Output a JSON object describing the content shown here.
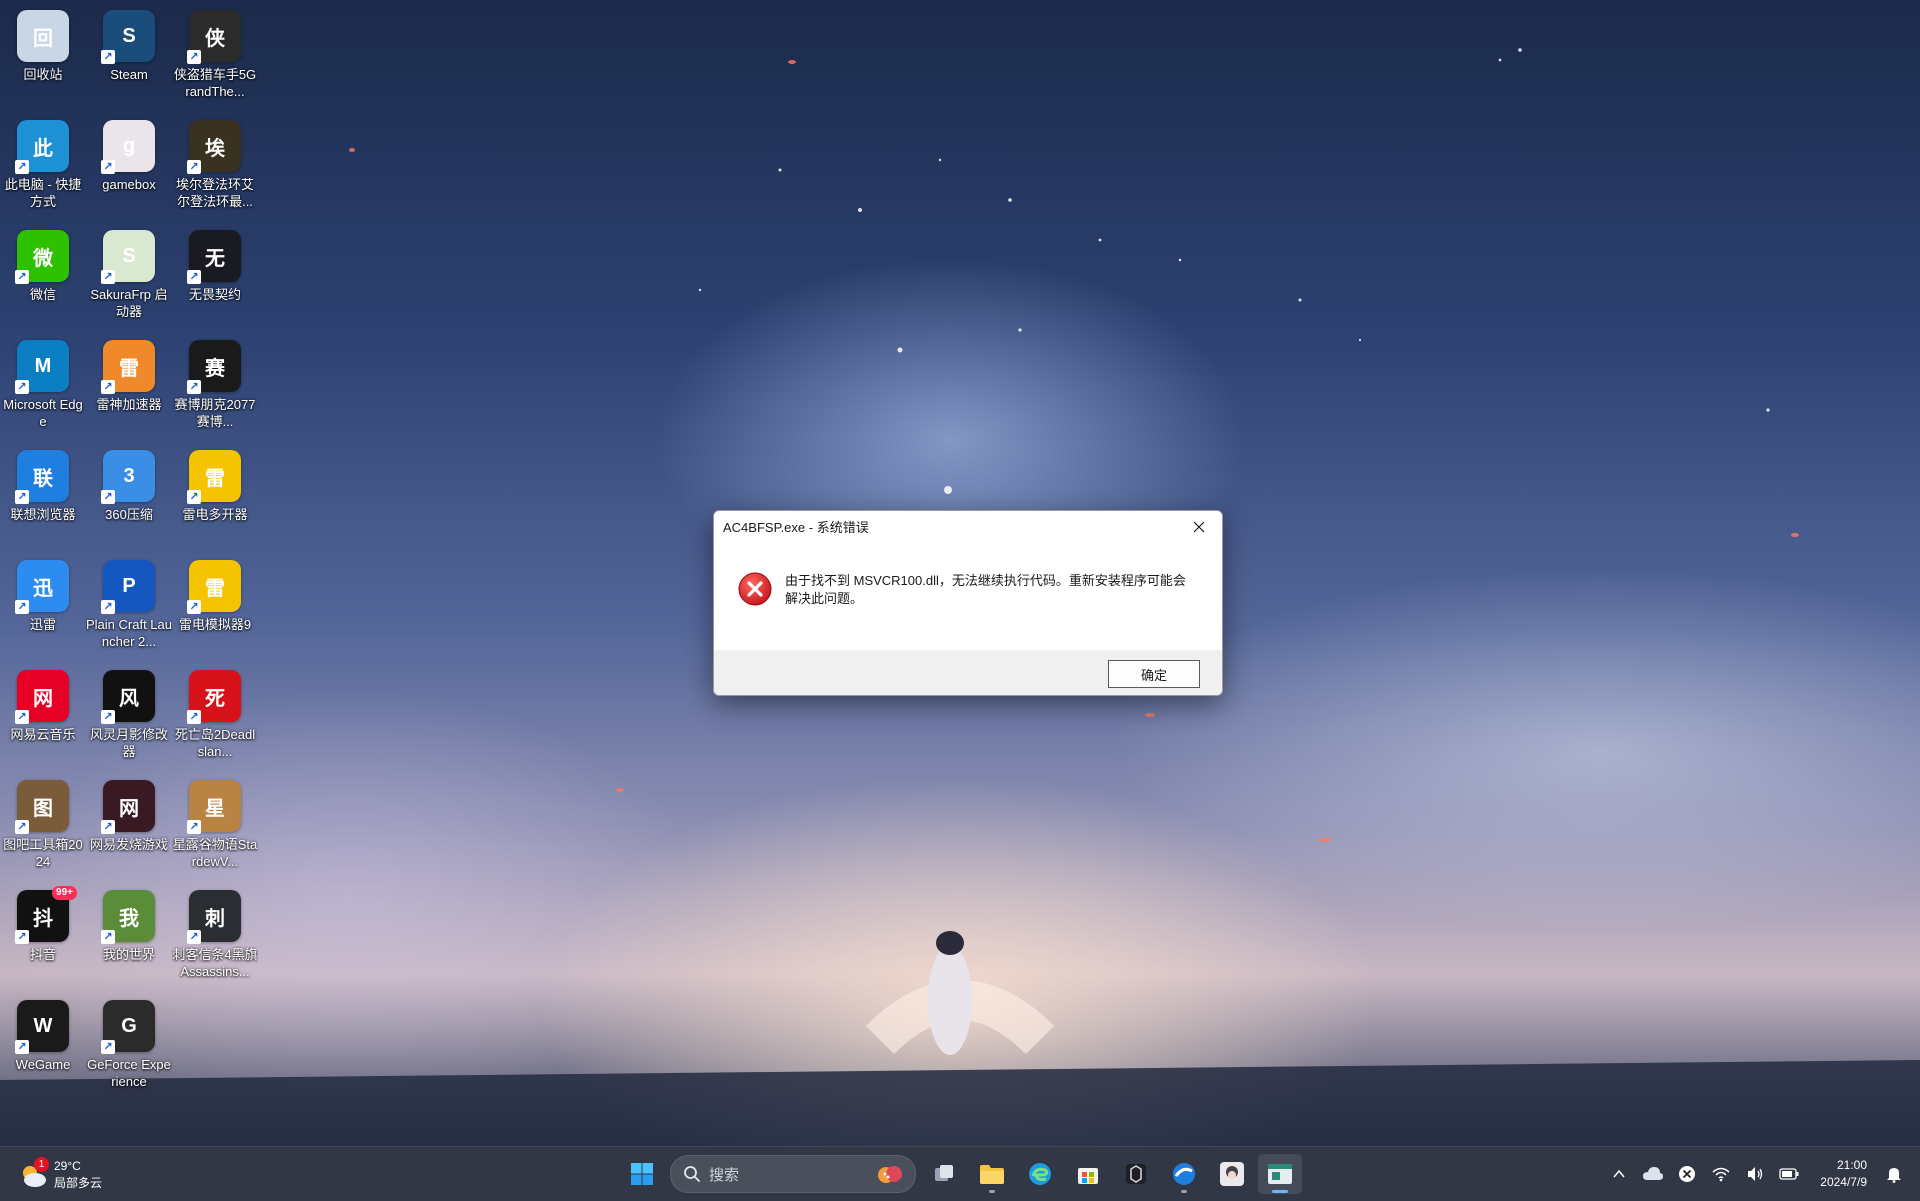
{
  "desktop_icons": [
    {
      "label": "回收站",
      "icon": "recycle-bin-icon",
      "color": "#c9d6e6"
    },
    {
      "label": "Steam",
      "icon": "steam-icon",
      "color": "#1b4d7a"
    },
    {
      "label": "侠盗猎车手5GrandThe...",
      "icon": "gta-v-icon",
      "color": "#2b2b2b"
    },
    {
      "label": "此电脑 - 快捷方式",
      "icon": "computer-icon",
      "color": "#1e90d6"
    },
    {
      "label": "gamebox",
      "icon": "gamebox-icon",
      "color": "#e9e5ea"
    },
    {
      "label": "埃尔登法环艾尔登法环最...",
      "icon": "elden-ring-icon",
      "color": "#3a3220"
    },
    {
      "label": "微信",
      "icon": "wechat-icon",
      "color": "#2dc100"
    },
    {
      "label": "SakuraFrp 启动器",
      "icon": "sakurafrp-icon",
      "color": "#d9e8d0"
    },
    {
      "label": "无畏契约",
      "icon": "valorant-icon",
      "color": "#1a1a22"
    },
    {
      "label": "Microsoft Edge",
      "icon": "edge-icon",
      "color": "#0c7fc4"
    },
    {
      "label": "雷神加速器",
      "icon": "leishen-accelerator-icon",
      "color": "#f0892a"
    },
    {
      "label": "赛博朋克2077赛博...",
      "icon": "cyberpunk-icon",
      "color": "#1a1a1a"
    },
    {
      "label": "联想浏览器",
      "icon": "lenovo-browser-icon",
      "color": "#1e7fe0"
    },
    {
      "label": "360压缩",
      "icon": "360-zip-icon",
      "color": "#3a8ee6"
    },
    {
      "label": "雷电多开器",
      "icon": "leidian-multi-icon",
      "color": "#f5c400"
    },
    {
      "label": "迅雷",
      "icon": "xunlei-icon",
      "color": "#2d8cf0"
    },
    {
      "label": "Plain Craft Launcher 2...",
      "icon": "pcl-icon",
      "color": "#1557c0"
    },
    {
      "label": "雷电模拟器9",
      "icon": "leidian-emulator-icon",
      "color": "#f5c400"
    },
    {
      "label": "网易云音乐",
      "icon": "netease-music-icon",
      "color": "#e60026"
    },
    {
      "label": "风灵月影修改器",
      "icon": "fengling-trainer-icon",
      "color": "#111111"
    },
    {
      "label": "死亡岛2Deadlslan...",
      "icon": "dead-island-icon",
      "color": "#d8121b"
    },
    {
      "label": "图吧工具箱2024",
      "icon": "tuba-toolbox-icon",
      "color": "#7a5c3a"
    },
    {
      "label": "网易发烧游戏",
      "icon": "netease-game-icon",
      "color": "#3a1a22"
    },
    {
      "label": "星露谷物语StardewV...",
      "icon": "stardew-icon",
      "color": "#b98443"
    },
    {
      "label": "抖音",
      "icon": "douyin-icon",
      "color": "#111111",
      "badge": "99+"
    },
    {
      "label": "我的世界",
      "icon": "minecraft-icon",
      "color": "#5a8c3a"
    },
    {
      "label": "刺客信条4黑旗Assassins...",
      "icon": "assassins-creed-icon",
      "color": "#2a2e33"
    },
    {
      "label": "WeGame",
      "icon": "wegame-icon",
      "color": "#1a1a1a"
    },
    {
      "label": "GeForce Experience",
      "icon": "geforce-icon",
      "color": "#2b2b2b"
    }
  ],
  "dialog": {
    "title": "AC4BFSP.exe - 系统错误",
    "message_line1": "由于找不到 MSVCR100.dll，无法继续执行代码。重新安装程序可能会",
    "message_line2": "解决此问题。",
    "ok_label": "确定"
  },
  "taskbar": {
    "weather_temp": "29°C",
    "weather_desc": "局部多云",
    "weather_badge": "1",
    "search_placeholder": "搜索",
    "time": "21:00",
    "date": "2024/7/9"
  }
}
